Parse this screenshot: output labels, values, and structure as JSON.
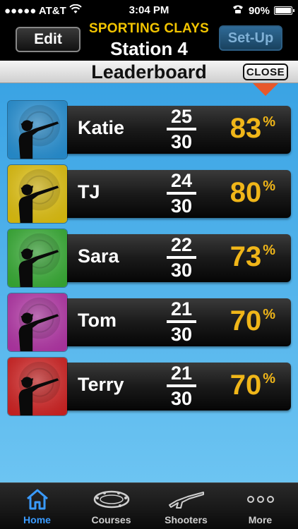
{
  "status_bar": {
    "carrier": "●●●●● AT&T",
    "time": "3:04 PM",
    "battery": "90%"
  },
  "header": {
    "edit_label": "Edit",
    "app_title": "SPORTING CLAYS",
    "station_title": "Station 4",
    "setup_label": "Set-Up"
  },
  "leaderboard": {
    "title": "Leaderboard",
    "close_label": "CLOSE",
    "players": [
      {
        "name": "Katie",
        "hits": "25",
        "total": "30",
        "percent": "83",
        "color": "#2a9de6"
      },
      {
        "name": "TJ",
        "hits": "24",
        "total": "30",
        "percent": "80",
        "color": "#f2d010"
      },
      {
        "name": "Sara",
        "hits": "22",
        "total": "30",
        "percent": "73",
        "color": "#3dbb3a"
      },
      {
        "name": "Tom",
        "hits": "21",
        "total": "30",
        "percent": "70",
        "color": "#c23ab4"
      },
      {
        "name": "Terry",
        "hits": "21",
        "total": "30",
        "percent": "70",
        "color": "#e22626"
      }
    ],
    "percent_sign": "%"
  },
  "colors": {
    "accent_yellow": "#f2c400",
    "percent_gold": "#f0b619",
    "active_tab": "#3a9bff",
    "close_arrow": "#e8582a"
  },
  "tabs": [
    {
      "label": "Home",
      "icon": "home-icon",
      "active": true
    },
    {
      "label": "Courses",
      "icon": "courses-icon",
      "active": false
    },
    {
      "label": "Shooters",
      "icon": "shooters-icon",
      "active": false
    },
    {
      "label": "More",
      "icon": "more-icon",
      "active": false
    }
  ]
}
